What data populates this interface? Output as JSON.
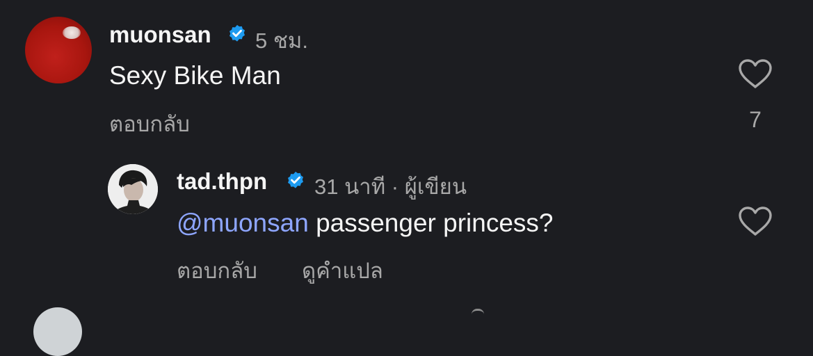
{
  "comments": [
    {
      "username": "muonsan",
      "verified": true,
      "time": "5 ชม.",
      "text": "Sexy Bike Man",
      "reply_label": "ตอบกลับ",
      "like_count": "7",
      "avatar_color": "#b3170f"
    },
    {
      "username": "tad.thpn",
      "verified": true,
      "time": "31 นาที",
      "separator": "·",
      "role": "ผู้เขียน",
      "mention": "@muonsan",
      "text": "passenger princess?",
      "reply_label": "ตอบกลับ",
      "translate_label": "ดูคำแปล"
    }
  ],
  "colors": {
    "background": "#1c1d21",
    "primary_text": "#f5f5f5",
    "secondary_text": "#a8a8a8",
    "mention": "#8ea6ff",
    "verified_badge": "#1d9bf0"
  },
  "icons": {
    "verified": "verified-badge-icon",
    "like": "heart-outline-icon"
  }
}
